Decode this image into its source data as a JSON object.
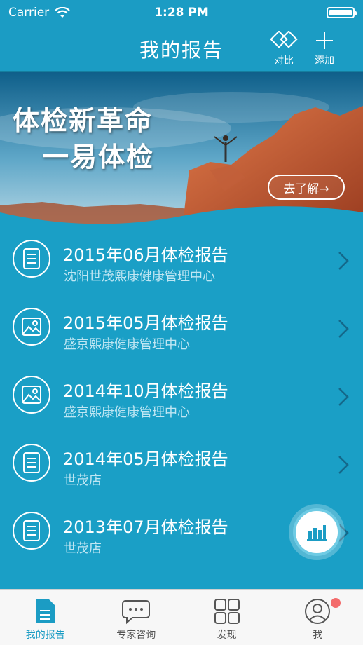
{
  "status_bar": {
    "carrier": "Carrier",
    "time": "1:28 PM"
  },
  "nav": {
    "title": "我的报告",
    "compare_label": "对比",
    "add_label": "添加"
  },
  "banner": {
    "line1": "体检新革命",
    "line2": "一易体检",
    "button_label": "去了解→"
  },
  "reports": [
    {
      "title": "2015年06月体检报告",
      "subtitle": "沈阳世茂熙康健康管理中心",
      "icon": "document-icon"
    },
    {
      "title": "2015年05月体检报告",
      "subtitle": "盛京熙康健康管理中心",
      "icon": "image-icon"
    },
    {
      "title": "2014年10月体检报告",
      "subtitle": "盛京熙康健康管理中心",
      "icon": "image-icon"
    },
    {
      "title": "2014年05月体检报告",
      "subtitle": "世茂店",
      "icon": "document-icon"
    },
    {
      "title": "2013年07月体检报告",
      "subtitle": "世茂店",
      "icon": "document-icon"
    }
  ],
  "tabs": [
    {
      "label": "我的报告",
      "icon": "report-icon",
      "active": true
    },
    {
      "label": "专家咨询",
      "icon": "chat-icon",
      "active": false
    },
    {
      "label": "发现",
      "icon": "grid-icon",
      "active": false
    },
    {
      "label": "我",
      "icon": "person-icon",
      "active": false
    }
  ],
  "colors": {
    "primary": "#1b9cc4",
    "list_bg": "#1a9fc6",
    "subtitle": "#bfe6f3",
    "tab_bg": "#f7f7f7",
    "badge": "#f36b6b"
  }
}
